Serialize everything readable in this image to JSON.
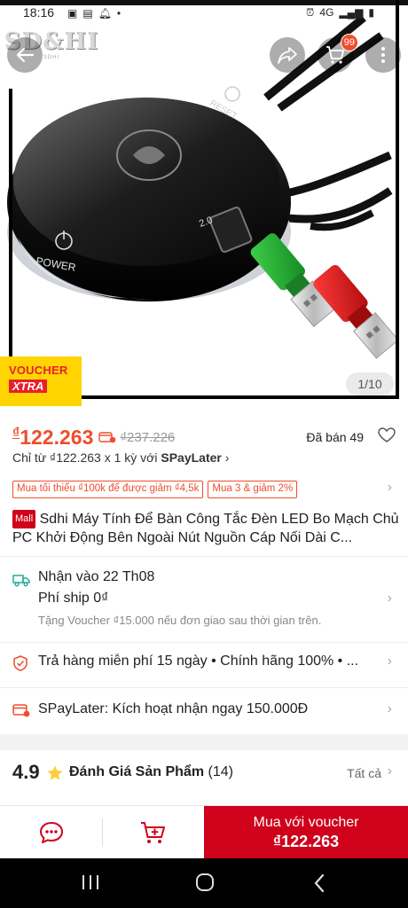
{
  "status_bar": {
    "time": "18:16",
    "left_icons": [
      "image-icon",
      "notification-icon",
      "alarm-icon",
      "dot-icon"
    ],
    "right_icons": [
      "alarm-clock-icon",
      "4g-icon",
      "signal-icon",
      "signal-icon-2",
      "battery-icon"
    ],
    "network": "4G"
  },
  "watermark": {
    "text": "SD&HI",
    "subtitle": "SDHI"
  },
  "header": {
    "cart_count": "99"
  },
  "gallery": {
    "page_indicator": "1/10",
    "device_labels": {
      "reset": "RESET",
      "power": "POWER",
      "usb": "2.0"
    }
  },
  "voucher_badge": {
    "top": "VOUCHER",
    "bottom": "XTRA"
  },
  "price": {
    "currency": "₫",
    "current": "122.263",
    "original": "₫237.226",
    "sold": "Đã bán 49"
  },
  "installment": {
    "prefix": "Chỉ từ ₫122.263 x 1 kỳ với ",
    "provider": "SPayLater",
    "chevron": "›"
  },
  "promos": [
    "Mua tối thiểu ₫100k để được giảm ₫4,5k",
    "Mua 3 & giảm 2%"
  ],
  "product": {
    "mall_tag": "Mall",
    "title": "Sdhi Máy Tính Để Bàn Công Tắc Đèn LED Bo Mạch Chủ PC Khởi Động Bên Ngoài Nút Nguồn Cáp Nối Dài C..."
  },
  "shipping": {
    "line1": "Nhận vào 22 Th08",
    "line2": "Phí ship 0₫",
    "line3": "Tặng Voucher ₫15.000 nếu đơn giao sau thời gian trên."
  },
  "returns": {
    "text": "Trả hàng miễn phí 15 ngày  •  Chính hãng 100%  •  ..."
  },
  "spaylater": {
    "text": "SPayLater: Kích hoạt nhận ngay 150.000Đ"
  },
  "rating": {
    "score": "4.9",
    "label": "Đánh Giá Sản Phẩm",
    "count": "(14)",
    "see_all": "Tất cả"
  },
  "actions": {
    "buy_label": "Mua với voucher",
    "buy_price": "₫122.263"
  },
  "colors": {
    "accent": "#ee4d2d",
    "buy_button": "#d0011b",
    "voucher_yellow": "#ffd400",
    "star": "#ffce3d"
  }
}
